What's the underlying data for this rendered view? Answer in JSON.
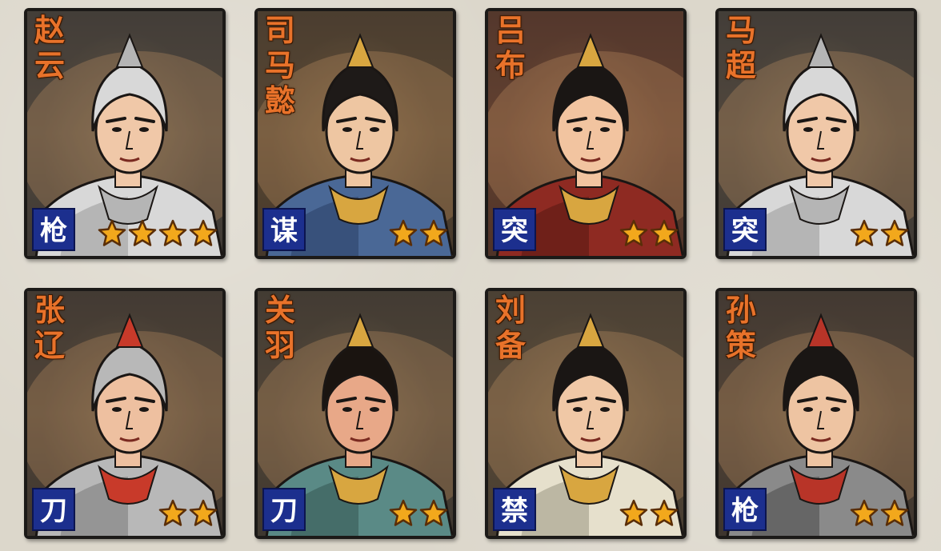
{
  "colors": {
    "name_text": "#e8722a",
    "type_badge": "#1c2f8e",
    "star_fill": "#f2a81c",
    "star_stroke": "#5a2e08"
  },
  "generals": [
    {
      "name": "赵云",
      "type": "枪",
      "stars": 4,
      "palette": "silver"
    },
    {
      "name": "司马懿",
      "type": "谋",
      "stars": 2,
      "palette": "blue"
    },
    {
      "name": "吕布",
      "type": "突",
      "stars": 2,
      "palette": "red"
    },
    {
      "name": "马超",
      "type": "突",
      "stars": 2,
      "palette": "silver"
    },
    {
      "name": "张辽",
      "type": "刀",
      "stars": 2,
      "palette": "redplume"
    },
    {
      "name": "关羽",
      "type": "刀",
      "stars": 2,
      "palette": "teal"
    },
    {
      "name": "刘备",
      "type": "禁",
      "stars": 2,
      "palette": "ivory"
    },
    {
      "name": "孙策",
      "type": "枪",
      "stars": 2,
      "palette": "mail"
    }
  ]
}
